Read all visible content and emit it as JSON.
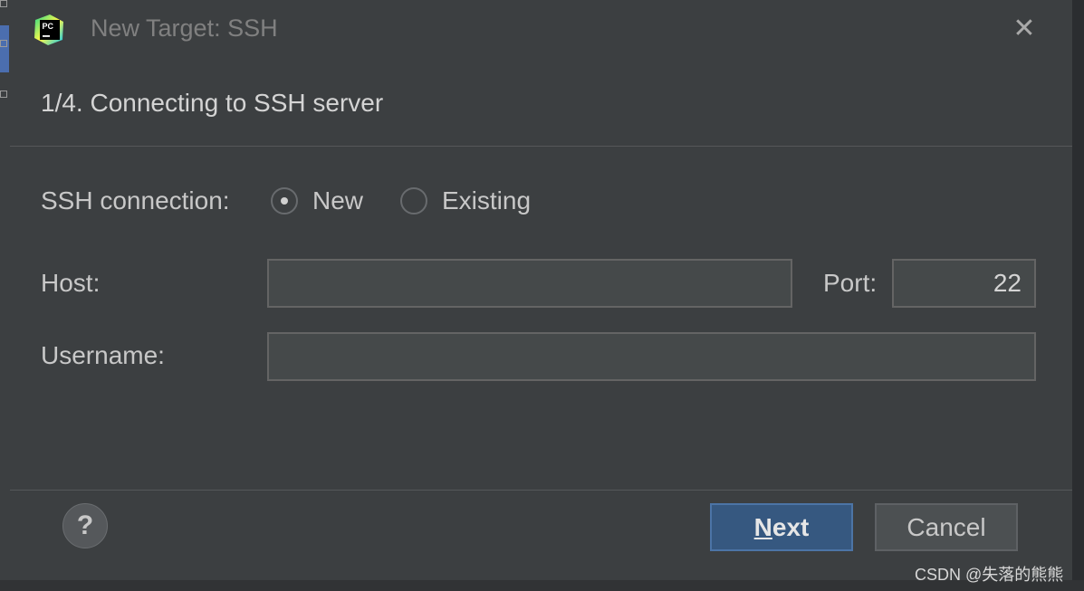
{
  "window": {
    "title": "New Target: SSH",
    "app_icon_text": "PC",
    "close_glyph": "✕"
  },
  "step": {
    "title": "1/4. Connecting to SSH server"
  },
  "connection": {
    "label": "SSH connection:",
    "options": [
      "New",
      "Existing"
    ],
    "selected": "New"
  },
  "host": {
    "label": "Host:",
    "value": ""
  },
  "port": {
    "label": "Port:",
    "value": "22"
  },
  "username": {
    "label": "Username:",
    "value": ""
  },
  "footer": {
    "help_glyph": "?",
    "next_mnemonic": "N",
    "next_rest": "ext",
    "cancel_label": "Cancel"
  },
  "watermark": "CSDN @失落的熊熊",
  "colors": {
    "dialog_bg": "#3c3f41",
    "accent": "#365880"
  }
}
